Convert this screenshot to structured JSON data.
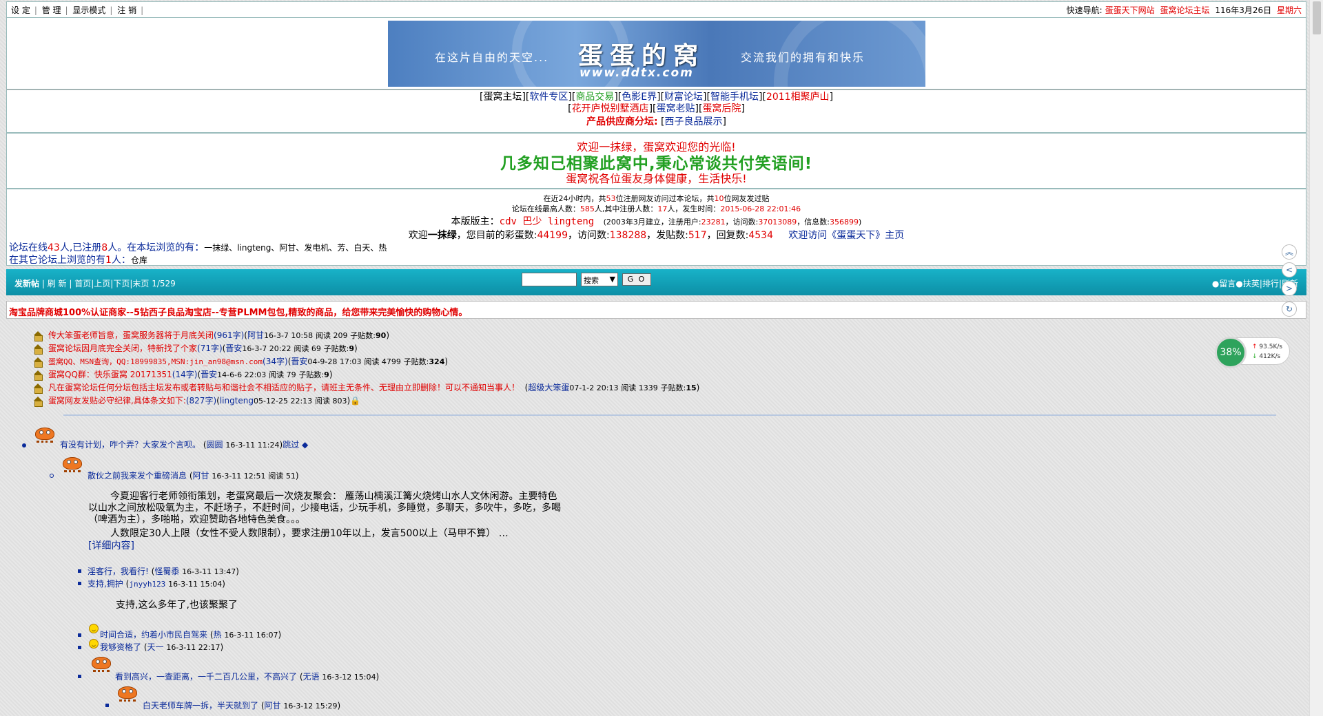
{
  "topbar": {
    "menu": [
      "设 定",
      "管 理",
      "显示模式",
      "注 销"
    ],
    "quicknav_label": "快速导航:",
    "quicknav_links": [
      "蛋蛋天下网站",
      "蛋窝论坛主坛"
    ],
    "date": "116年3月26日",
    "weekday": "星期六"
  },
  "banner": {
    "left_text": "在这片自由的天空...",
    "name": "蛋蛋的窝",
    "url": "www.ddtx.com",
    "right_text": "交流我们的拥有和快乐"
  },
  "nav": {
    "row1": [
      "蛋窝主坛",
      "软件专区",
      "商品交易",
      "色影E界",
      "财富论坛",
      "智能手机坛",
      "2011相聚庐山"
    ],
    "row2": [
      "花开庐悦别墅酒店",
      "蛋窝老贴",
      "蛋窝后院"
    ],
    "supplier_label": "产品供应商分坛:",
    "supplier_link": "西子良品展示"
  },
  "welcome": {
    "line1": "欢迎一抹绿，蛋窝欢迎您的光临!",
    "line2": "几多知己相聚此窝中,秉心常谈共付笑语间!",
    "line3": "蛋窝祝各位蛋友身体健康，生活快乐!"
  },
  "stats": {
    "line1_a": "在近24小时内，共",
    "reg_visitors": "53",
    "line1_b": "位注册网友访问过本论坛，共",
    "guest_visitors": "10",
    "line1_c": "位网友发过贴",
    "line2_a": "论坛在线最高人数：",
    "max_online": "585",
    "line2_b": "人,其中注册人数：",
    "max_reg": "17",
    "line2_c": "人，发生时间：",
    "max_time": "2015-06-28 22:01:46",
    "mod_label": "本版版主：",
    "moderators": "cdv 巴少 lingteng",
    "founded": "(2003年3月建立，注册用户:",
    "users": "23281",
    "visits_label": "，访问数:",
    "visits": "37013089",
    "msgs_label": "，信息数:",
    "msgs": "356899",
    "welcome_a": "欢迎",
    "welcome_user": "一抹绿",
    "welcome_b": "，您目前的彩蛋数:",
    "eggs": "44199",
    "visits2_label": "，访问数:",
    "visits2": "138288",
    "posts_label": "，发贴数:",
    "posts": "517",
    "replies_label": "，回复数:",
    "replies": "4534",
    "home_link": "欢迎访问《蛋蛋天下》主页"
  },
  "online": {
    "line1_a": "论坛在线",
    "total": "43",
    "line1_b": "人,已注册",
    "registered": "8",
    "line1_c": "人。在本坛浏览的有：",
    "browsing": "一抹绿、lingteng、阿甘、发电机、芳、白天、热",
    "line2_a": "在其它论坛上浏览的有",
    "other": "1",
    "line2_b": "人：",
    "other_users": "仓库"
  },
  "toolbar": {
    "new_post": "发新帖",
    "refresh": "刷 新",
    "first": "首页",
    "prev": "上页",
    "next": "下页",
    "last": "末页",
    "page": "1/529",
    "search_select": "搜索",
    "go": "G O",
    "right_links": [
      "●留言",
      "●扶英",
      "排行",
      "刷新"
    ]
  },
  "ad": "淘宝品牌商城100%认证商家--5钻西子良品淘宝店--专营PLMM包包,精致的商品，给您带来完美愉快的购物心情。",
  "net_widget": {
    "percent": "38%",
    "up": "93.5K/s",
    "down": "412K/s"
  },
  "sticky": [
    {
      "title": "传大笨蛋老师旨意，蛋窝服务器将于月底关闭",
      "size": "(961字)",
      "author": "阿甘",
      "time": "16-3-7 10:58",
      "reads": "阅读 209",
      "replies_label": "子贴数:",
      "replies": "90"
    },
    {
      "title": "蛋窝论坛因月底完全关闭，特新找了个家",
      "size": "(71字)",
      "author": "晋安",
      "time": "16-3-7 20:22",
      "reads": "阅读 69",
      "replies_label": "子贴数:",
      "replies": "9"
    },
    {
      "title": "蛋窝QQ、MSN查询，QQ:18999835,MSN:jin_an98@msn.com",
      "size": "(34字)",
      "author": "晋安",
      "time": "04-9-28 17:03",
      "reads": "阅读 4799",
      "replies_label": "子贴数:",
      "replies": "324"
    },
    {
      "title": "蛋窝QQ群：快乐蛋窝 20171351",
      "size": "(14字)",
      "author": "晋安",
      "time": "14-6-6 22:03",
      "reads": "阅读 79",
      "replies_label": "子贴数:",
      "replies": "9"
    },
    {
      "title": "凡在蛋窝论坛任何分坛包括主坛发布或者转贴与和谐社会不相适应的贴子，请班主无条件、无理由立即删除！可以不通知当事人！",
      "size": "",
      "author": "超级大笨蛋",
      "time": "07-1-2 20:13",
      "reads": "阅读 1339",
      "replies_label": "子贴数:",
      "replies": "15"
    },
    {
      "title": "蛋窝网友发贴必守纪律,具体条文如下:",
      "size": "(827字)",
      "author": "lingteng",
      "time": "05-12-25 22:13",
      "reads": "阅读 803",
      "replies_label": "",
      "replies": ""
    }
  ],
  "thread": {
    "root": {
      "title": "有没有计划，咋个弄？大家发个言呗。",
      "author": "圆圆",
      "time": "16-3-11 11:24",
      "skip": "跳过 ◆"
    },
    "p1": {
      "title": "散伙之前我来发个重磅消息",
      "author": "阿甘",
      "time": "16-3-11 12:51",
      "reads": "阅读 51"
    },
    "p1_body": "今夏迎客行老师领衔策划，老蛋窝最后一次烧友聚会：  雁荡山楠溪江篝火烧烤山水人文休闲游。主要特色以山水之间放松吸氧为主，不赶场子，不赶时间，少接电话，少玩手机，多睡觉，多聊天，多吹牛，多吃，多喝（啤酒为主），多啪啪，欢迎赞助各地特色美食。。。",
    "p1_body2": "人数限定30人上限（女性不受人数限制），要求注册10年以上，发言500以上（马甲不算）  …",
    "p1_more": "[详细内容]",
    "r1": {
      "title": "淫客行，我看行!",
      "author": "怪蜀黍",
      "time": "16-3-11 13:47"
    },
    "r2": {
      "title": "支持,拥护",
      "author": "jnyyh123",
      "time": "16-3-11 15:04"
    },
    "r2_body": "支持,这么多年了,也该聚聚了",
    "r3": {
      "title": "时间合适，约着小市民自驾来",
      "author": "热",
      "time": "16-3-11 16:07"
    },
    "r4": {
      "title": "我够资格了",
      "author": "天一",
      "time": "16-3-11 22:17"
    },
    "r5": {
      "title": "看到高兴，一查距离，一千二百几公里，不高兴了",
      "author": "无语",
      "time": "16-3-12 15:04"
    },
    "r6": {
      "title": "白天老师车牌一拆，半天就到了",
      "author": "阿甘",
      "time": "16-3-12 15:29"
    }
  }
}
